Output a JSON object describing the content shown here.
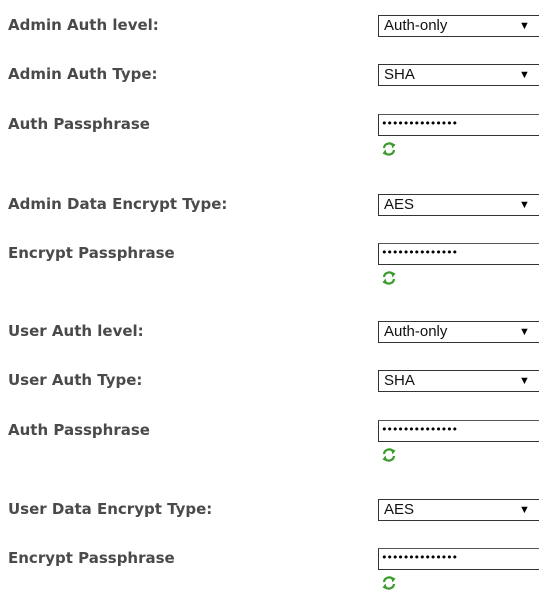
{
  "admin": {
    "auth_level": {
      "label": "Admin Auth level:",
      "value": "Auth-only"
    },
    "auth_type": {
      "label": "Admin Auth Type:",
      "value": "SHA"
    },
    "auth_passphrase": {
      "label": "Auth Passphrase",
      "value": "••••••••••••••"
    },
    "data_encrypt_type": {
      "label": "Admin Data Encrypt Type:",
      "value": "AES"
    },
    "encrypt_passphrase": {
      "label": "Encrypt Passphrase",
      "value": "••••••••••••••"
    }
  },
  "user": {
    "auth_level": {
      "label": "User Auth level:",
      "value": "Auth-only"
    },
    "auth_type": {
      "label": "User Auth Type:",
      "value": "SHA"
    },
    "auth_passphrase": {
      "label": "Auth Passphrase",
      "value": "••••••••••••••"
    },
    "data_encrypt_type": {
      "label": "User Data Encrypt Type:",
      "value": "AES"
    },
    "encrypt_passphrase": {
      "label": "Encrypt Passphrase",
      "value": "••••••••••••••"
    }
  },
  "icons": {
    "dropdown_arrow": "▼",
    "refresh": "refresh-icon"
  },
  "colors": {
    "label_text": "#4a4a4a",
    "refresh_green": "#3c9a2e"
  }
}
